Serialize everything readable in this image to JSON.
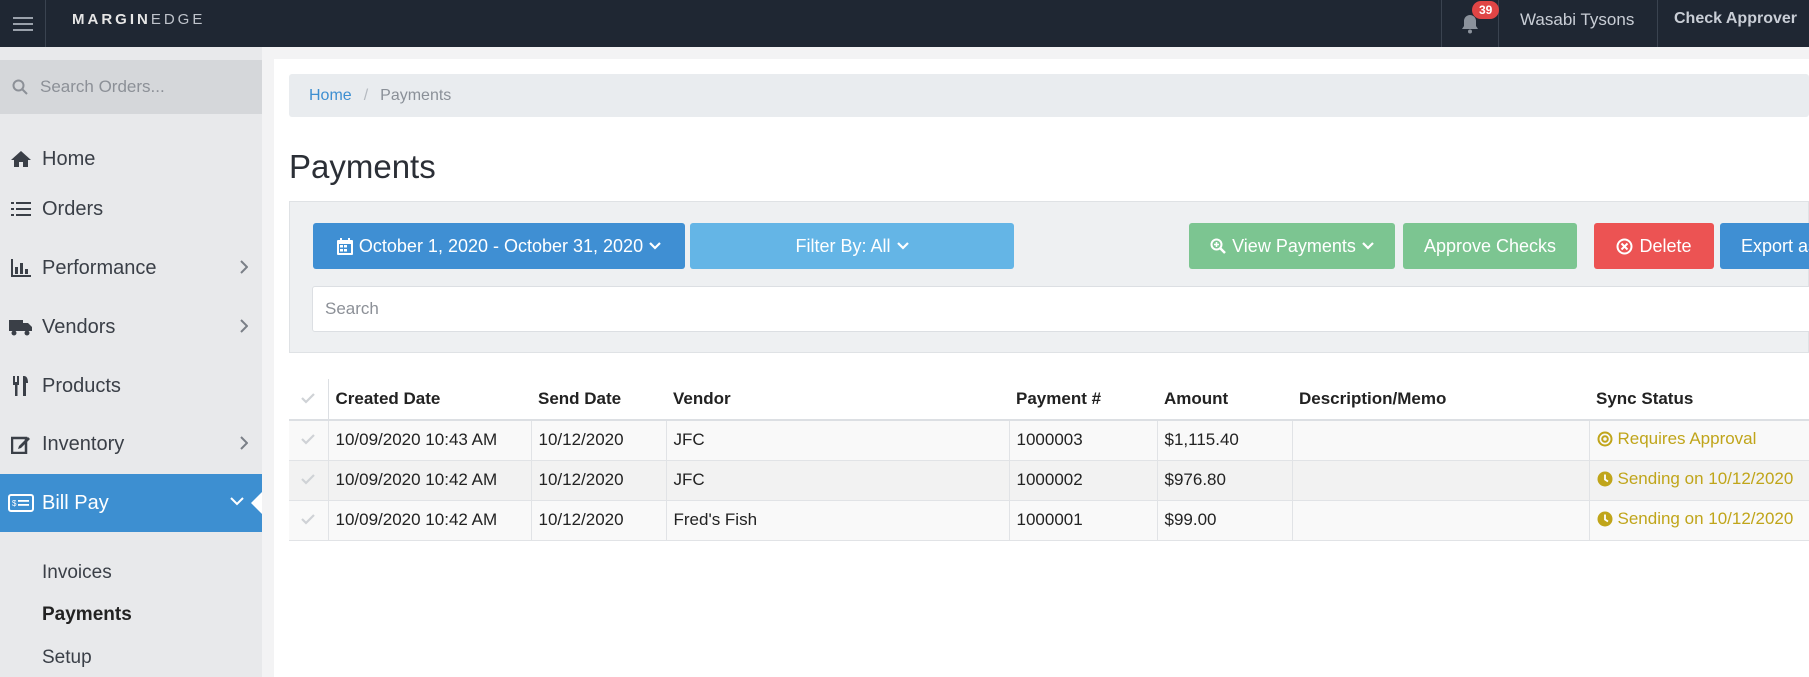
{
  "app": {
    "brand_bold": "MARGIN",
    "brand_light": "EDGE",
    "notification_count": "39",
    "user_name": "Wasabi Tysons",
    "role": "Check Approver"
  },
  "sidebar": {
    "search_placeholder": "Search Orders...",
    "items": [
      {
        "label": "Home",
        "icon": "home-icon"
      },
      {
        "label": "Orders",
        "icon": "list-icon"
      },
      {
        "label": "Performance",
        "icon": "bar-chart-icon"
      },
      {
        "label": "Vendors",
        "icon": "truck-icon"
      },
      {
        "label": "Products",
        "icon": "utensils-icon"
      },
      {
        "label": "Inventory",
        "icon": "edit-icon"
      },
      {
        "label": "Bill Pay",
        "icon": "money-bill-icon"
      }
    ],
    "sub_items": [
      "Invoices",
      "Payments",
      "Setup"
    ]
  },
  "breadcrumb": {
    "home": "Home",
    "separator": "/",
    "current": "Payments"
  },
  "page": {
    "title": "Payments"
  },
  "toolbar": {
    "date_range": "October 1, 2020 - October 31, 2020",
    "filter_label": "Filter By: All",
    "view_payments": "View Payments",
    "approve_checks": "Approve Checks",
    "delete": "Delete",
    "export": "Export as",
    "search_placeholder": "Search"
  },
  "table": {
    "columns": [
      "Created Date",
      "Send Date",
      "Vendor",
      "Payment #",
      "Amount",
      "Description/Memo",
      "Sync Status"
    ],
    "rows": [
      {
        "created": "10/09/2020 10:43 AM",
        "send": "10/12/2020",
        "vendor": "JFC",
        "payment": "1000003",
        "amount": "$1,115.40",
        "memo": "",
        "status": "Requires Approval"
      },
      {
        "created": "10/09/2020 10:42 AM",
        "send": "10/12/2020",
        "vendor": "JFC",
        "payment": "1000002",
        "amount": "$976.80",
        "memo": "",
        "status": "Sending on 10/12/2020"
      },
      {
        "created": "10/09/2020 10:42 AM",
        "send": "10/12/2020",
        "vendor": "Fred's Fish",
        "payment": "1000001",
        "amount": "$99.00",
        "memo": "",
        "status": "Sending on 10/12/2020"
      }
    ]
  },
  "colors": {
    "topbar": "#1f2733",
    "primary": "#3f8fd3",
    "info": "#64b5e6",
    "success": "#7cc591",
    "danger": "#ec5353",
    "warning_text": "#c0a51a"
  }
}
